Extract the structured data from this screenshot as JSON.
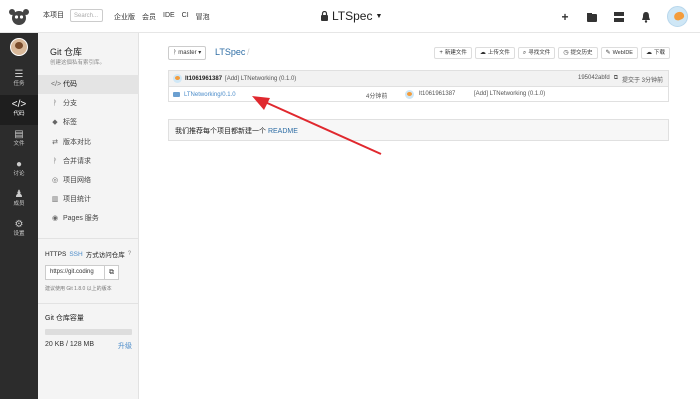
{
  "topbar": {
    "scope_tag": "本项目",
    "search_placeholder": "Search...",
    "links": [
      "企业版",
      "会员",
      "IDE",
      "CI",
      "冒泡"
    ],
    "project_title": "LTSpec"
  },
  "iconbar": {
    "items": [
      {
        "glyph": "☰",
        "label": "任务",
        "icon": "tasks-icon"
      },
      {
        "glyph": "</>",
        "label": "代码",
        "icon": "code-icon"
      },
      {
        "glyph": "▤",
        "label": "文件",
        "icon": "file-icon"
      },
      {
        "glyph": "●",
        "label": "讨论",
        "icon": "discuss-icon"
      },
      {
        "glyph": "♟",
        "label": "成员",
        "icon": "members-icon"
      },
      {
        "glyph": "⚙",
        "label": "设置",
        "icon": "settings-icon"
      }
    ]
  },
  "sidebar": {
    "repo_title": "Git 仓库",
    "repo_subtitle": "创建这個私有索引库。",
    "menu": [
      {
        "icon": "</>",
        "label": "代码"
      },
      {
        "icon": "ᚹ",
        "label": "分支"
      },
      {
        "icon": "◆",
        "label": "标签"
      },
      {
        "icon": "⇄",
        "label": "版本对比"
      },
      {
        "icon": "ᚹ",
        "label": "合并请求"
      },
      {
        "icon": "◎",
        "label": "项目网络"
      },
      {
        "icon": "▥",
        "label": "项目统计"
      },
      {
        "icon": "◉",
        "label": "Pages 服务"
      }
    ],
    "https": {
      "proto": "HTTPS",
      "ssh": "SSH",
      "suffix": "方式访问仓库",
      "clone_value": "https://git.coding",
      "note": "建议使用 Git 1.8.0 以上的版本"
    },
    "storage": {
      "title": "Git 仓库容量",
      "usage": "20 KB / 128 MB",
      "upgrade": "升级",
      "used_fraction": 0.0002
    }
  },
  "main": {
    "branch": "master",
    "repo_crumb": "LTSpec",
    "crumb_sep": "/",
    "actions": [
      {
        "icon": "+",
        "label": "新建文件"
      },
      {
        "icon": "☁",
        "label": "上传文件"
      },
      {
        "icon": "⌕",
        "label": "寻找文件"
      },
      {
        "icon": "◷",
        "label": "提交历史"
      },
      {
        "icon": "✎",
        "label": "WebIDE"
      },
      {
        "icon": "☁",
        "label": "下载"
      }
    ],
    "commit": {
      "user": "lt1061961387",
      "message": "[Add] LTNetworking (0.1.0)",
      "hash": "195042abfd",
      "submitted_at": "提交于 3分钟前"
    },
    "file": {
      "name": "LTNetworking/0.1.0",
      "time": "4分钟前",
      "user": "lt1061961387",
      "message": "[Add] LTNetworking (0.1.0)"
    },
    "readme": {
      "text": "我们推荐每个项目都新建一个",
      "link": "README"
    }
  },
  "colors": {
    "accent": "#2f6ea5",
    "sidebar_dark": "#2c2c2c",
    "arrow": "#e0282e"
  }
}
